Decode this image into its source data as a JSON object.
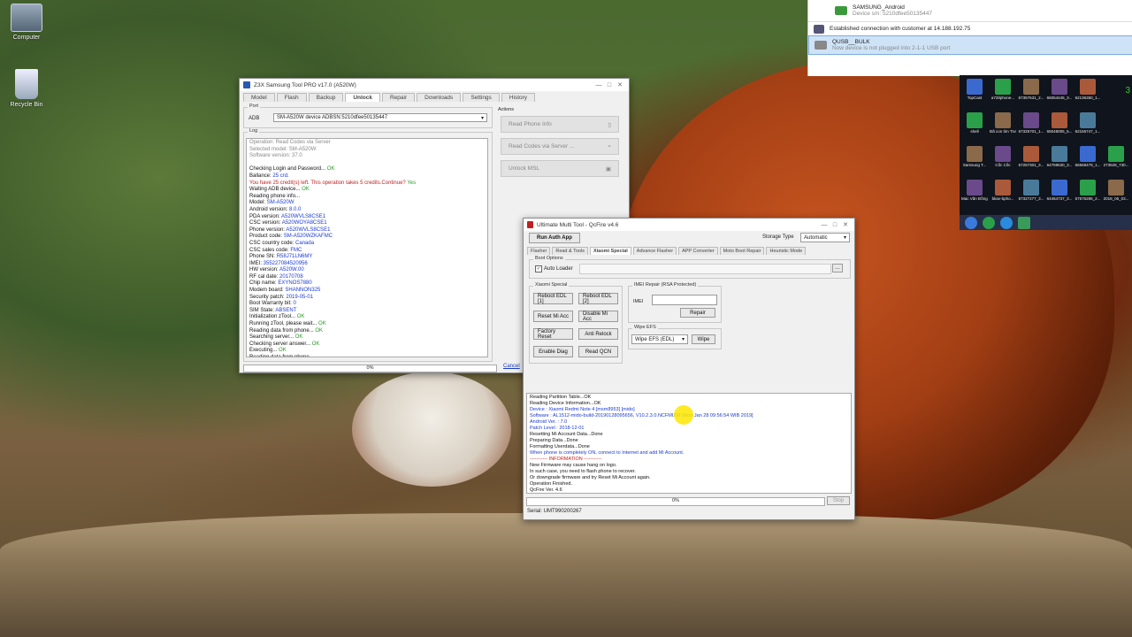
{
  "desktop": {
    "icons": [
      {
        "label": "Computer"
      },
      {
        "label": "Recycle Bin"
      }
    ]
  },
  "notifications": {
    "device1": {
      "title": "SAMSUNG_Android",
      "sub": "Device s/n: 5210dfee50135447"
    },
    "connection": {
      "title": "Established connection with customer at 14.188.192.75"
    },
    "device2": {
      "title": "QUSB__BULK",
      "sub": "Now device is not plugged into 2-1-1 USB port"
    },
    "side_number": "3",
    "tray_row1": [
      {
        "label": "TopCast"
      },
      {
        "label": "a728phone..."
      },
      {
        "label": "67357631_2..."
      },
      {
        "label": "66054445_3..."
      },
      {
        "label": "62136350_1..."
      }
    ],
    "tray_row2": [
      {
        "label": "shell"
      },
      {
        "label": "Đã con tìm Trường p..."
      },
      {
        "label": "67325701_1..."
      },
      {
        "label": "65048005_5..."
      },
      {
        "label": "62155747_1..."
      }
    ],
    "tray_row3": [
      {
        "label": "Samsung T..."
      },
      {
        "label": "Cốc Cốc"
      },
      {
        "label": "67257301_3..."
      },
      {
        "label": "64759530_3..."
      },
      {
        "label": "66568479_1..."
      },
      {
        "label": "273528_730..."
      }
    ],
    "tray_row4": [
      {
        "label": "Mac Văn Đồng.html"
      },
      {
        "label": "bkav-bpho..."
      },
      {
        "label": "67327277_3..."
      },
      {
        "label": "64454737_3..."
      },
      {
        "label": "57575286_2..."
      },
      {
        "label": "2018_05_03..."
      }
    ]
  },
  "z3x": {
    "title": "Z3X Samsung Tool PRO v17.0 (A520W)",
    "tabs": [
      "Model",
      "Flash",
      "Backup",
      "Unlock",
      "Repair",
      "Downloads",
      "Settings",
      "History"
    ],
    "active_tab": "Unlock",
    "port_label": "Port",
    "port_type": "ADB",
    "port_value": "SM-A520W device ADBSN:5210dfee50135447",
    "log_label": "Log",
    "actions_label": "Actions",
    "actions": [
      "Read Phone Info",
      "Read Codes via Server ...",
      "Unlock MSL"
    ],
    "progress": "0%",
    "cancel": "Cancel",
    "log": [
      {
        "k": "Operation: Read Codes via Server",
        "v": "",
        "c": "gray"
      },
      {
        "k": "Selected model: SM-A520W",
        "v": "",
        "c": "gray"
      },
      {
        "k": "Software version: 37.0",
        "v": "",
        "c": "gray"
      },
      {
        "k": "",
        "v": "",
        "c": "gray"
      },
      {
        "k": "Checking Login and Password... ",
        "v": "OK",
        "c": "green"
      },
      {
        "k": "Ballance: ",
        "v": "25 crd.",
        "c": "blue"
      },
      {
        "k": "You have 25 credit(s) left. This operation takes 5 credits.Continue? ",
        "v": "Yes",
        "c": "redgreen"
      },
      {
        "k": "Waiting ADB device... ",
        "v": "OK",
        "c": "green"
      },
      {
        "k": "Reading phone info...",
        "v": "",
        "c": "black"
      },
      {
        "k": "Model: ",
        "v": "SM-A520W",
        "c": "blue"
      },
      {
        "k": "Android version: ",
        "v": "8.0.0",
        "c": "blue"
      },
      {
        "k": "PDA version: ",
        "v": "A520WVLS8CSE1",
        "c": "blue"
      },
      {
        "k": "CSC version: ",
        "v": "A520WOYA8CSE1",
        "c": "blue"
      },
      {
        "k": "Phone version: ",
        "v": "A520WVLS8CSE1",
        "c": "blue"
      },
      {
        "k": "Product code: ",
        "v": "SM-A520WZKAFMC",
        "c": "blue"
      },
      {
        "k": "CSC country code: ",
        "v": "Canada",
        "c": "blue"
      },
      {
        "k": "CSC sales code: ",
        "v": "FMC",
        "c": "blue"
      },
      {
        "k": "Phone SN: ",
        "v": "R58J71LN6MY",
        "c": "blue"
      },
      {
        "k": "IMEI: ",
        "v": "355227084520956",
        "c": "blue"
      },
      {
        "k": "HW version: ",
        "v": "A520W.00",
        "c": "blue"
      },
      {
        "k": "RF cal date: ",
        "v": "20170708",
        "c": "blue"
      },
      {
        "k": "Chip name: ",
        "v": "EXYNOS7880",
        "c": "blue"
      },
      {
        "k": "Modem board: ",
        "v": "SHANNON325",
        "c": "blue"
      },
      {
        "k": "Security patch: ",
        "v": "2019-05-01",
        "c": "blue"
      },
      {
        "k": "Boot Warranty bit: ",
        "v": "0",
        "c": "blue"
      },
      {
        "k": "SIM State: ",
        "v": "ABSENT",
        "c": "blue"
      },
      {
        "k": "Initialization zTool... ",
        "v": "OK",
        "c": "green"
      },
      {
        "k": "Running zTool, please wait... ",
        "v": "OK",
        "c": "green"
      },
      {
        "k": "Reading data from phone... ",
        "v": "OK",
        "c": "green"
      },
      {
        "k": "Searching server... ",
        "v": "OK",
        "c": "green"
      },
      {
        "k": "Checking server answer... ",
        "v": "OK",
        "c": "green"
      },
      {
        "k": "Executing... ",
        "v": "OK",
        "c": "green"
      },
      {
        "k": "Reading data from phone...",
        "v": "",
        "c": "black"
      }
    ]
  },
  "umt": {
    "title": "Ultimate Multi Tool - QcFire v4.6",
    "run_auth": "Run Auth App",
    "storage_label": "Storage Type",
    "storage_value": "Automatic",
    "tabs": [
      "Flasher",
      "Read & Tools",
      "Xiaomi Special",
      "Advance Flasher",
      "APP Converter",
      "Moto Boot Repair",
      "Heuristic Mode"
    ],
    "active_tab": "Xiaomi Special",
    "boot_options": "Boot Options",
    "auto_loader": "Auto Loader",
    "xiaomi_special": "Xiaomi Special",
    "buttons": [
      "Reboot EDL [1]",
      "Reboot EDL [2]",
      "Reset Mi Acc",
      "Disable Mi Acc",
      "Factory Reset",
      "Anti Relock",
      "Enable Diag",
      "Read QCN"
    ],
    "imei_repair": "IMEI Repair (RSA Protected)",
    "imei_label": "IMEI",
    "repair": "Repair",
    "wipe_efs": "Wipe EFS",
    "wipe_efs_select": "Wipe EFS (EDL)",
    "wipe": "Wipe",
    "progress": "0%",
    "stop": "Stop",
    "serial": "Serial: UMT990200267",
    "log": [
      {
        "k": "Reading Partition Table...OK",
        "v": "",
        "c": "black"
      },
      {
        "k": "Reading Device Information...OK",
        "v": "",
        "c": "black"
      },
      {
        "k": "Device      ",
        "v": ": Xiaomi Redmi Note 4 [msm8953] [mido]",
        "c": "blue"
      },
      {
        "k": "Software    ",
        "v": ": AL1512-mido-build-20190128095656, V10.2.3.0.NCFMIXM [Mon Jan 28 09:56:54 WIB 2019]",
        "c": "blue"
      },
      {
        "k": "Android Ver.  ",
        "v": ": 7.0",
        "c": "blue"
      },
      {
        "k": "Patch Level   ",
        "v": ": 2018-12-01",
        "c": "blue"
      },
      {
        "k": "Resetting Mi Account Data...Done",
        "v": "",
        "c": "black"
      },
      {
        "k": "Preparing Data...Done",
        "v": "",
        "c": "black"
      },
      {
        "k": "Formatting Userdata...Done",
        "v": "",
        "c": "black"
      },
      {
        "k": "When phone is completely ON, connect to Internet and add Mi Account.",
        "v": "",
        "c": "blueall"
      },
      {
        "k": "----------- INFORMATION -----------",
        "v": "",
        "c": "red"
      },
      {
        "k": "New Firmware may cause hang on logo.",
        "v": "",
        "c": "black"
      },
      {
        "k": "In such case, you need to flash phone to recover.",
        "v": "",
        "c": "black"
      },
      {
        "k": "Or downgrade firmware and try Reset Mi Account again.",
        "v": "",
        "c": "black"
      },
      {
        "k": "Operation Finished.",
        "v": "",
        "c": "black"
      },
      {
        "k": "QcFire Ver. 4.6",
        "v": "",
        "c": "black"
      }
    ]
  },
  "colors": {
    "accent_blue": "#1a3ad0",
    "ok_green": "#2a9a2a",
    "warn_red": "#c02020"
  }
}
